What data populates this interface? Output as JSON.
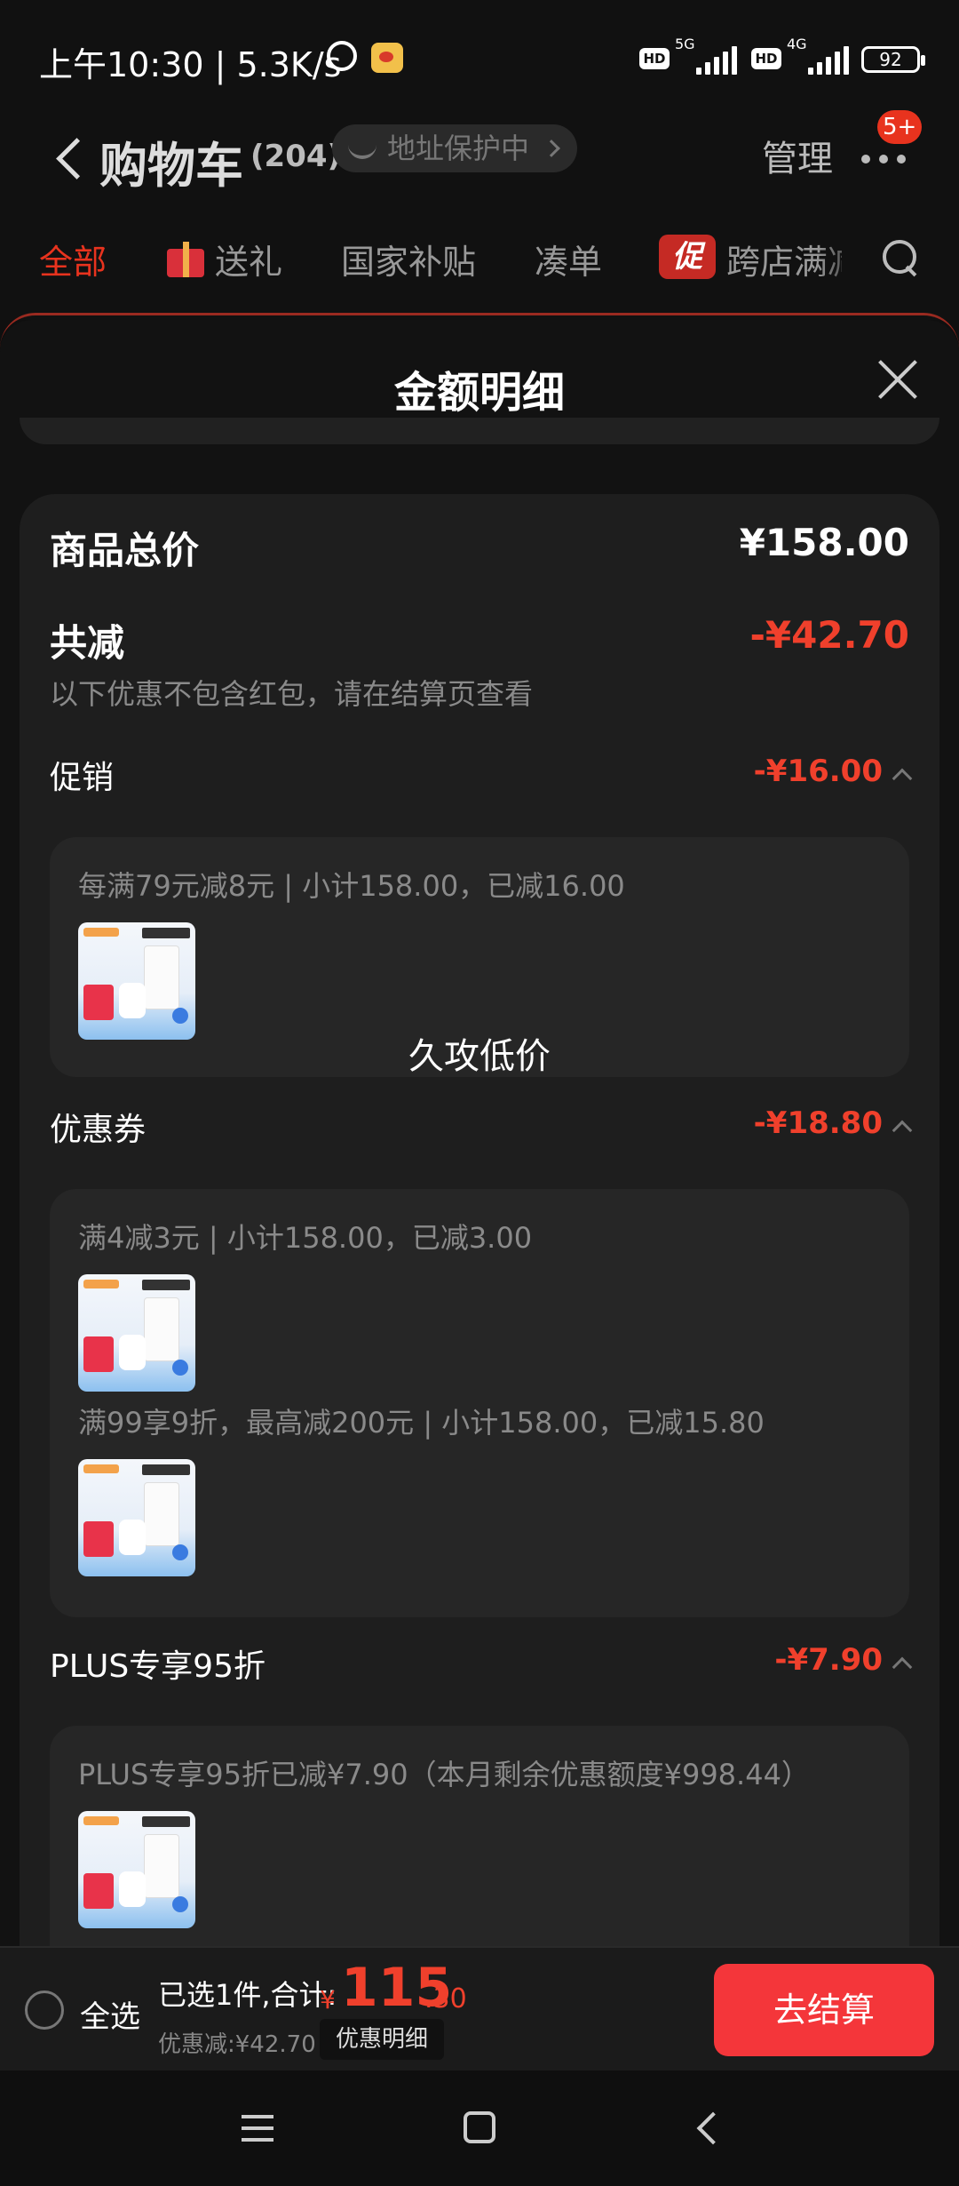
{
  "status_bar": {
    "time": "上午10:30 | 5.3K/s",
    "alarm_icon": "alarm-icon",
    "app_icon": "weibo-icon",
    "hd1": "HD",
    "sim1_type": "5G",
    "hd2": "HD",
    "sim2_type": "4G",
    "battery": "92"
  },
  "header": {
    "title": "购物车",
    "count": "(204)",
    "address_pill": "地址保护中",
    "manage": "管理",
    "notification_badge": "5+"
  },
  "tabs": [
    {
      "label": "全部",
      "active": true
    },
    {
      "label": "送礼",
      "icon": "gift-icon"
    },
    {
      "label": "国家补贴"
    },
    {
      "label": "凑单"
    },
    {
      "label": "跨店满减",
      "icon": "promo-icon",
      "icon_text": "促"
    }
  ],
  "sheet": {
    "title": "金额明细",
    "total_label": "商品总价",
    "total_value": "¥158.00",
    "discount_label": "共减",
    "discount_value": "-¥42.70",
    "discount_note": "以下优惠不包含红包，请在结算页查看",
    "sections": [
      {
        "label": "促销",
        "value": "-¥16.00",
        "details": [
          "每满79元减8元 | 小计158.00，已减16.00"
        ]
      },
      {
        "label": "优惠券",
        "value": "-¥18.80",
        "details": [
          "满4减3元 | 小计158.00，已减3.00",
          "满99享9折，最高减200元 | 小计158.00，已减15.80"
        ]
      },
      {
        "label": "PLUS专享95折",
        "value": "-¥7.90",
        "details": [
          "PLUS专享95折已减¥7.90（本月剩余优惠额度¥998.44）"
        ]
      }
    ],
    "toast": "久攻低价"
  },
  "bottom_bar": {
    "select_all": "全选",
    "summary_prefix": "已选1件,合计:",
    "currency": "¥",
    "total_integer": "115",
    "total_decimal": ".30",
    "discount_text": "优惠减:¥42.70",
    "detail_button": "优惠明细",
    "checkout_button": "去结算"
  },
  "colors": {
    "accent_red": "#f0402c",
    "checkout_red": "#f4363a",
    "background": "#121212"
  }
}
